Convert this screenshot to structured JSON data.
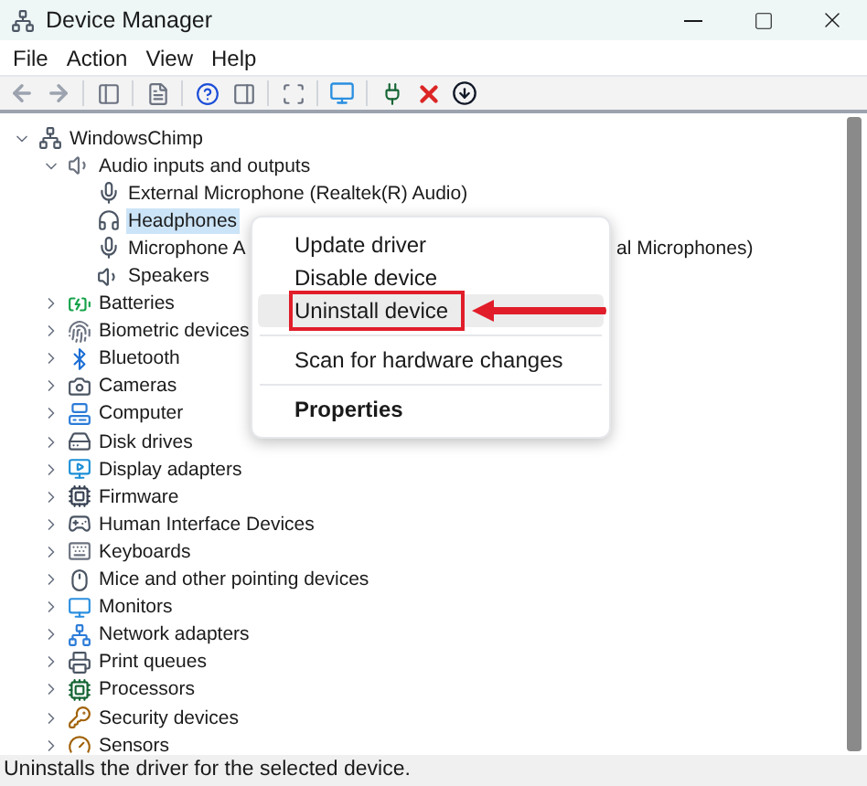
{
  "window": {
    "title": "Device Manager"
  },
  "menu_bar": [
    "File",
    "Action",
    "View",
    "Help"
  ],
  "tree": {
    "label": "WindowsChimp",
    "expanded": true,
    "selected": false,
    "children": [
      {
        "label": "Audio inputs and outputs",
        "expanded": true,
        "selected": false,
        "children": [
          {
            "label": "External Microphone (Realtek(R) Audio)",
            "selected": false
          },
          {
            "label": "Headphones",
            "selected": true
          },
          {
            "label": "Microphone A",
            "tail": "al Microphones)",
            "selected": false
          },
          {
            "label": "Speakers",
            "selected": false
          }
        ]
      },
      {
        "label": "Batteries",
        "expanded": false,
        "selected": false
      },
      {
        "label": "Biometric devices",
        "expanded": false,
        "selected": false
      },
      {
        "label": "Bluetooth",
        "expanded": false,
        "selected": false
      },
      {
        "label": "Cameras",
        "expanded": false,
        "selected": false
      },
      {
        "label": "Computer",
        "expanded": false,
        "selected": false
      },
      {
        "label": "Disk drives",
        "expanded": false,
        "selected": false
      },
      {
        "label": "Display adapters",
        "expanded": false,
        "selected": false
      },
      {
        "label": "Firmware",
        "expanded": false,
        "selected": false
      },
      {
        "label": "Human Interface Devices",
        "expanded": false,
        "selected": false
      },
      {
        "label": "Keyboards",
        "expanded": false,
        "selected": false
      },
      {
        "label": "Mice and other pointing devices",
        "expanded": false,
        "selected": false
      },
      {
        "label": "Monitors",
        "expanded": false,
        "selected": false
      },
      {
        "label": "Network adapters",
        "expanded": false,
        "selected": false
      },
      {
        "label": "Print queues",
        "expanded": false,
        "selected": false
      },
      {
        "label": "Processors",
        "expanded": false,
        "selected": false
      },
      {
        "label": "Security devices",
        "expanded": false,
        "selected": false
      },
      {
        "label": "Sensors",
        "expanded": false,
        "selected": false
      }
    ]
  },
  "context_menu": [
    {
      "kind": "item",
      "label": "Update driver",
      "bold": false,
      "selected": false
    },
    {
      "kind": "item",
      "label": "Disable device",
      "bold": false,
      "selected": false
    },
    {
      "kind": "item",
      "label": "Uninstall device",
      "bold": false,
      "selected": true
    },
    {
      "kind": "separator"
    },
    {
      "kind": "item",
      "label": "Scan for hardware changes",
      "bold": false,
      "selected": false
    },
    {
      "kind": "separator"
    },
    {
      "kind": "item",
      "label": "Properties",
      "bold": true,
      "selected": false
    }
  ],
  "status_bar": "Uninstalls the driver for the selected device."
}
